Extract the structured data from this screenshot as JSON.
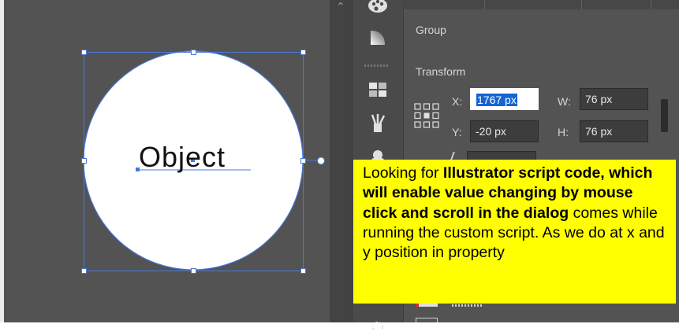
{
  "canvas": {
    "object_text": "Object"
  },
  "panel": {
    "group_label": "Group",
    "transform_title": "Transform",
    "x_label": "X:",
    "x_value": "1767 px",
    "y_label": "Y:",
    "y_value": "-20 px",
    "w_label": "W:",
    "w_value": "76 px",
    "h_label": "H:",
    "h_value": "76 px"
  },
  "callout": {
    "seg1": "Looking for ",
    "seg2": "Illustrator script code, which will enable value changing by mouse click and scroll in the dialog",
    "seg3": " comes while running the custom script. As we do at x and y position in property"
  },
  "icons": {
    "scroll_up": "chevron-up-icon",
    "tools": [
      "color-palette-icon",
      "gradient-icon",
      "swatches-grid-icon",
      "brushes-icon",
      "symbols-icon",
      "appearance-icon"
    ],
    "reference_point": "reference-point-icon"
  },
  "colors": {
    "canvas_bg": "#535353",
    "selection": "#4a78d8",
    "callout_bg": "#ffff00",
    "highlight": "#1464d2"
  }
}
